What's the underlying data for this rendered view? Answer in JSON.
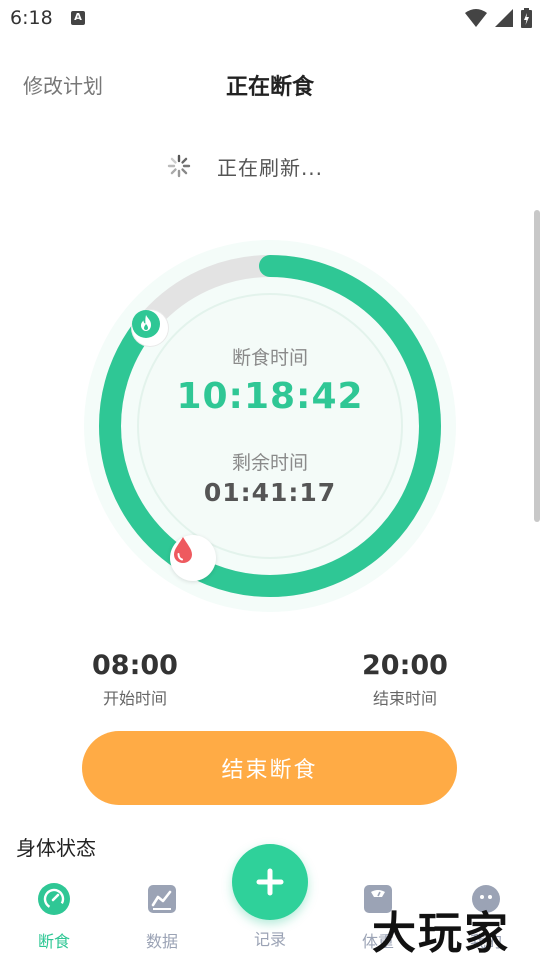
{
  "status_bar": {
    "time": "6:18",
    "app_badge": "A",
    "icons": [
      "wifi-icon",
      "signal-icon",
      "battery-icon"
    ]
  },
  "header": {
    "left_link": "修改计划",
    "title": "正在断食"
  },
  "refresh": {
    "text": "正在刷新..."
  },
  "timer": {
    "elapsed_label": "断食时间",
    "elapsed_value": "10:18:42",
    "remaining_label": "剩余时间",
    "remaining_value": "01:41:17",
    "progress_fraction": 0.86
  },
  "schedule": {
    "start_time": "08:00",
    "start_label": "开始时间",
    "end_time": "20:00",
    "end_label": "结束时间"
  },
  "end_button": {
    "label": "结束断食"
  },
  "body_status": {
    "title": "身体状态"
  },
  "tabbar": {
    "tabs": [
      {
        "label": "断食",
        "icon": "fasting-gauge-icon",
        "active": true
      },
      {
        "label": "数据",
        "icon": "chart-icon",
        "active": false
      },
      {
        "label": "记录",
        "icon": "plus-icon",
        "active": false
      },
      {
        "label": "体重",
        "icon": "scale-icon",
        "active": false
      },
      {
        "label": "我的",
        "icon": "profile-icon",
        "active": false
      }
    ]
  },
  "watermark": {
    "text": "大玩家"
  },
  "colors": {
    "accent_green": "#2fc795",
    "button_orange": "#ffab45",
    "inactive_tab": "#9ba3b5"
  }
}
